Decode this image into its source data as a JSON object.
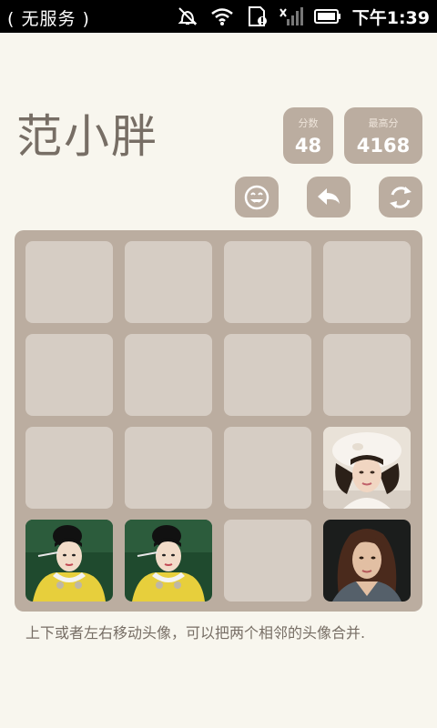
{
  "status_bar": {
    "carrier": "( 无服务 )",
    "time": "下午1:39",
    "icons": [
      "alarm-off-icon",
      "wifi-icon",
      "sd-card-icon",
      "no-signal-icon",
      "battery-icon"
    ]
  },
  "app": {
    "title": "范小胖"
  },
  "score": {
    "label": "分数",
    "value": "48"
  },
  "best": {
    "label": "最高分",
    "value": "4168"
  },
  "actions": {
    "icons": [
      "smiley-icon",
      "undo-icon",
      "restart-icon"
    ]
  },
  "board": {
    "rows": 4,
    "cols": 4,
    "tiles": [
      [
        null,
        null,
        null,
        null
      ],
      [
        null,
        null,
        null,
        null
      ],
      [
        null,
        null,
        null,
        "portrait-white-hat"
      ],
      [
        "portrait-yellow-costume",
        "portrait-yellow-costume",
        null,
        "portrait-dark-hair"
      ]
    ]
  },
  "instructions": "上下或者左右移动头像，可以把两个相邻的头像合并."
}
